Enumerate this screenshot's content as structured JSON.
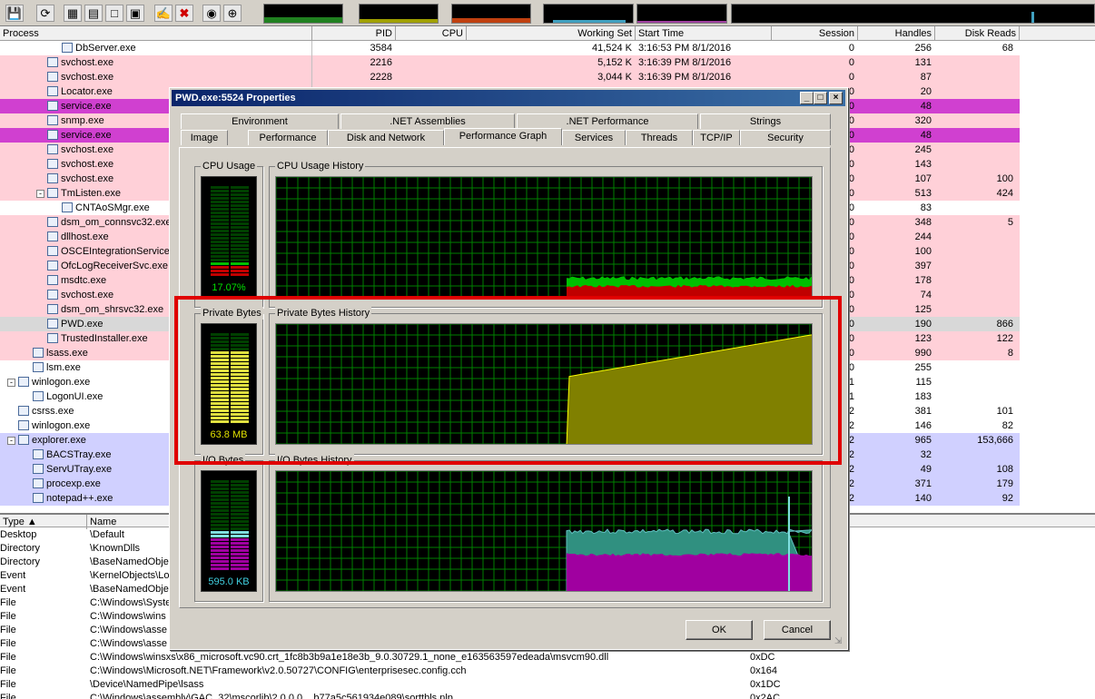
{
  "toolbar": {
    "buttons": [
      "save-icon",
      "refresh-icon",
      "system-info-icon",
      "properties-icon",
      "window-icon",
      "find-window-icon",
      "options-icon",
      "kill-process-icon",
      "find-icon",
      "target-icon"
    ]
  },
  "columns": {
    "process": "Process",
    "pid": "PID",
    "cpu": "CPU",
    "working_set": "Working Set",
    "start_time": "Start Time",
    "session": "Session",
    "handles": "Handles",
    "disk_reads": "Disk Reads"
  },
  "processes": [
    {
      "name": "DbServer.exe",
      "pid": "3584",
      "ws": "41,524 K",
      "start": "3:16:53 PM 8/1/2016",
      "session": "0",
      "handles": "256",
      "reads": "68",
      "indent": 4,
      "bg": "#ffffff"
    },
    {
      "name": "svchost.exe",
      "pid": "2216",
      "ws": "5,152 K",
      "start": "3:16:39 PM 8/1/2016",
      "session": "0",
      "handles": "131",
      "reads": "",
      "indent": 3,
      "bg": "#ffd0d8"
    },
    {
      "name": "svchost.exe",
      "pid": "2228",
      "ws": "3,044 K",
      "start": "3:16:39 PM 8/1/2016",
      "session": "0",
      "handles": "87",
      "reads": "",
      "indent": 3,
      "bg": "#ffd0d8"
    },
    {
      "name": "Locator.exe",
      "pid": "",
      "ws": "",
      "start": "",
      "session": "0",
      "handles": "20",
      "reads": "",
      "indent": 3,
      "bg": "#ffd0d8"
    },
    {
      "name": "service.exe",
      "pid": "",
      "ws": "",
      "start": "",
      "session": "0",
      "handles": "48",
      "reads": "",
      "indent": 3,
      "bg": "#d040d0"
    },
    {
      "name": "snmp.exe",
      "pid": "",
      "ws": "",
      "start": "",
      "session": "0",
      "handles": "320",
      "reads": "",
      "indent": 3,
      "bg": "#ffd0d8"
    },
    {
      "name": "service.exe",
      "pid": "",
      "ws": "",
      "start": "",
      "session": "0",
      "handles": "48",
      "reads": "",
      "indent": 3,
      "bg": "#d040d0"
    },
    {
      "name": "svchost.exe",
      "pid": "",
      "ws": "",
      "start": "",
      "session": "0",
      "handles": "245",
      "reads": "",
      "indent": 3,
      "bg": "#ffd0d8"
    },
    {
      "name": "svchost.exe",
      "pid": "",
      "ws": "",
      "start": "",
      "session": "0",
      "handles": "143",
      "reads": "",
      "indent": 3,
      "bg": "#ffd0d8"
    },
    {
      "name": "svchost.exe",
      "pid": "",
      "ws": "",
      "start": "",
      "session": "0",
      "handles": "107",
      "reads": "100",
      "indent": 3,
      "bg": "#ffd0d8"
    },
    {
      "name": "TmListen.exe",
      "pid": "",
      "ws": "",
      "start": "",
      "session": "0",
      "handles": "513",
      "reads": "424",
      "indent": 3,
      "bg": "#ffd0d8",
      "expander": "-"
    },
    {
      "name": "CNTAoSMgr.exe",
      "pid": "",
      "ws": "",
      "start": "",
      "session": "0",
      "handles": "83",
      "reads": "",
      "indent": 4,
      "bg": "#ffffff"
    },
    {
      "name": "dsm_om_connsvc32.exe",
      "pid": "",
      "ws": "",
      "start": "",
      "session": "0",
      "handles": "348",
      "reads": "5",
      "indent": 3,
      "bg": "#ffd0d8"
    },
    {
      "name": "dllhost.exe",
      "pid": "",
      "ws": "",
      "start": "",
      "session": "0",
      "handles": "244",
      "reads": "",
      "indent": 3,
      "bg": "#ffd0d8"
    },
    {
      "name": "OSCEIntegrationService.exe",
      "pid": "",
      "ws": "",
      "start": "",
      "session": "0",
      "handles": "100",
      "reads": "",
      "indent": 3,
      "bg": "#ffd0d8"
    },
    {
      "name": "OfcLogReceiverSvc.exe",
      "pid": "",
      "ws": "",
      "start": "",
      "session": "0",
      "handles": "397",
      "reads": "",
      "indent": 3,
      "bg": "#ffd0d8"
    },
    {
      "name": "msdtc.exe",
      "pid": "",
      "ws": "",
      "start": "",
      "session": "0",
      "handles": "178",
      "reads": "",
      "indent": 3,
      "bg": "#ffd0d8"
    },
    {
      "name": "svchost.exe",
      "pid": "",
      "ws": "",
      "start": "",
      "session": "0",
      "handles": "74",
      "reads": "",
      "indent": 3,
      "bg": "#ffd0d8"
    },
    {
      "name": "dsm_om_shrsvc32.exe",
      "pid": "",
      "ws": "",
      "start": "",
      "session": "0",
      "handles": "125",
      "reads": "",
      "indent": 3,
      "bg": "#ffd0d8"
    },
    {
      "name": "PWD.exe",
      "pid": "",
      "ws": "",
      "start": "",
      "session": "0",
      "handles": "190",
      "reads": "866",
      "indent": 3,
      "bg": "#d8d8d8"
    },
    {
      "name": "TrustedInstaller.exe",
      "pid": "",
      "ws": "",
      "start": "",
      "session": "0",
      "handles": "123",
      "reads": "122",
      "indent": 3,
      "bg": "#ffd0d8"
    },
    {
      "name": "lsass.exe",
      "pid": "",
      "ws": "",
      "start": "",
      "session": "0",
      "handles": "990",
      "reads": "8",
      "indent": 2,
      "bg": "#ffd0d8"
    },
    {
      "name": "lsm.exe",
      "pid": "",
      "ws": "",
      "start": "",
      "session": "0",
      "handles": "255",
      "reads": "",
      "indent": 2,
      "bg": "#ffffff"
    },
    {
      "name": "winlogon.exe",
      "pid": "",
      "ws": "",
      "start": "",
      "session": "1",
      "handles": "115",
      "reads": "",
      "indent": 1,
      "bg": "#ffffff",
      "expander": "-"
    },
    {
      "name": "LogonUI.exe",
      "pid": "",
      "ws": "",
      "start": "",
      "session": "1",
      "handles": "183",
      "reads": "",
      "indent": 2,
      "bg": "#ffffff"
    },
    {
      "name": "csrss.exe",
      "pid": "",
      "ws": "",
      "start": "",
      "session": "2",
      "handles": "381",
      "reads": "101",
      "indent": 1,
      "bg": "#ffffff"
    },
    {
      "name": "winlogon.exe",
      "pid": "",
      "ws": "",
      "start": "",
      "session": "2",
      "handles": "146",
      "reads": "82",
      "indent": 1,
      "bg": "#ffffff"
    },
    {
      "name": "explorer.exe",
      "pid": "",
      "ws": "",
      "start": "",
      "session": "2",
      "handles": "965",
      "reads": "153,666",
      "indent": 1,
      "bg": "#d0d0ff",
      "expander": "-"
    },
    {
      "name": "BACSTray.exe",
      "pid": "",
      "ws": "",
      "start": "",
      "session": "2",
      "handles": "32",
      "reads": "",
      "indent": 2,
      "bg": "#d0d0ff"
    },
    {
      "name": "ServUTray.exe",
      "pid": "",
      "ws": "",
      "start": "",
      "session": "2",
      "handles": "49",
      "reads": "108",
      "indent": 2,
      "bg": "#d0d0ff"
    },
    {
      "name": "procexp.exe",
      "pid": "",
      "ws": "",
      "start": "",
      "session": "2",
      "handles": "371",
      "reads": "179",
      "indent": 2,
      "bg": "#d0d0ff"
    },
    {
      "name": "notepad++.exe",
      "pid": "",
      "ws": "",
      "start": "",
      "session": "2",
      "handles": "140",
      "reads": "92",
      "indent": 2,
      "bg": "#d0d0ff"
    }
  ],
  "lower_pane": {
    "col_type": "Type",
    "col_name": "Name",
    "rows": [
      {
        "type": "Desktop",
        "name": "\\Default",
        "handle": ""
      },
      {
        "type": "Directory",
        "name": "\\KnownDlls",
        "handle": ""
      },
      {
        "type": "Directory",
        "name": "\\BaseNamedObje",
        "handle": ""
      },
      {
        "type": "Event",
        "name": "\\KernelObjects\\Lo",
        "handle": ""
      },
      {
        "type": "Event",
        "name": "\\BaseNamedObje",
        "handle": ""
      },
      {
        "type": "File",
        "name": "C:\\Windows\\Syste",
        "handle": ""
      },
      {
        "type": "File",
        "name": "C:\\Windows\\wins",
        "handle": ""
      },
      {
        "type": "File",
        "name": "C:\\Windows\\asse",
        "handle": ""
      },
      {
        "type": "File",
        "name": "C:\\Windows\\asse",
        "handle": ""
      },
      {
        "type": "File",
        "name": "C:\\Windows\\winsxs\\x86_microsoft.vc90.crt_1fc8b3b9a1e18e3b_9.0.30729.1_none_e163563597edeada\\msvcm90.dll",
        "handle": "0xDC"
      },
      {
        "type": "File",
        "name": "C:\\Windows\\Microsoft.NET\\Framework\\v2.0.50727\\CONFIG\\enterprisesec.config.cch",
        "handle": "0x164"
      },
      {
        "type": "File",
        "name": "\\Device\\NamedPipe\\lsass",
        "handle": "0x1DC"
      },
      {
        "type": "File",
        "name": "C:\\Windows\\assembly\\GAC_32\\mscorlib\\2.0.0.0__b77a5c561934e089\\sorttbls.nlp",
        "handle": "0x2AC"
      }
    ]
  },
  "dialog": {
    "title": "PWD.exe:5524 Properties",
    "tabs_row1": [
      "Environment",
      ".NET Assemblies",
      ".NET Performance",
      "Strings"
    ],
    "tabs_row2": [
      "Image",
      "Performance",
      "Disk and Network",
      "Performance Graph",
      "Services",
      "Threads",
      "TCP/IP",
      "Security"
    ],
    "active_tab": "Performance Graph",
    "cpu": {
      "label": "CPU Usage",
      "history_label": "CPU Usage History",
      "value": "17.07%",
      "fraction": 0.17
    },
    "private_bytes": {
      "label": "Private Bytes",
      "history_label": "Private Bytes History",
      "value": "63.8 MB",
      "fraction": 0.78
    },
    "io_bytes": {
      "label": "I/O Bytes",
      "history_label": "I/O Bytes History",
      "value": "595.0  KB",
      "fraction": 0.42
    },
    "ok": "OK",
    "cancel": "Cancel"
  },
  "colors": {
    "pink": "#ffd0d8",
    "purple": "#d040d0",
    "blue": "#d0d0ff",
    "graph_grid": "#008000",
    "cpu_fill": "#00c000",
    "cpu_kernel": "#c00000",
    "pb_fill": "#808000",
    "pb_line": "#ffff00",
    "io_teal": "#309080",
    "io_magenta": "#a000a0"
  }
}
